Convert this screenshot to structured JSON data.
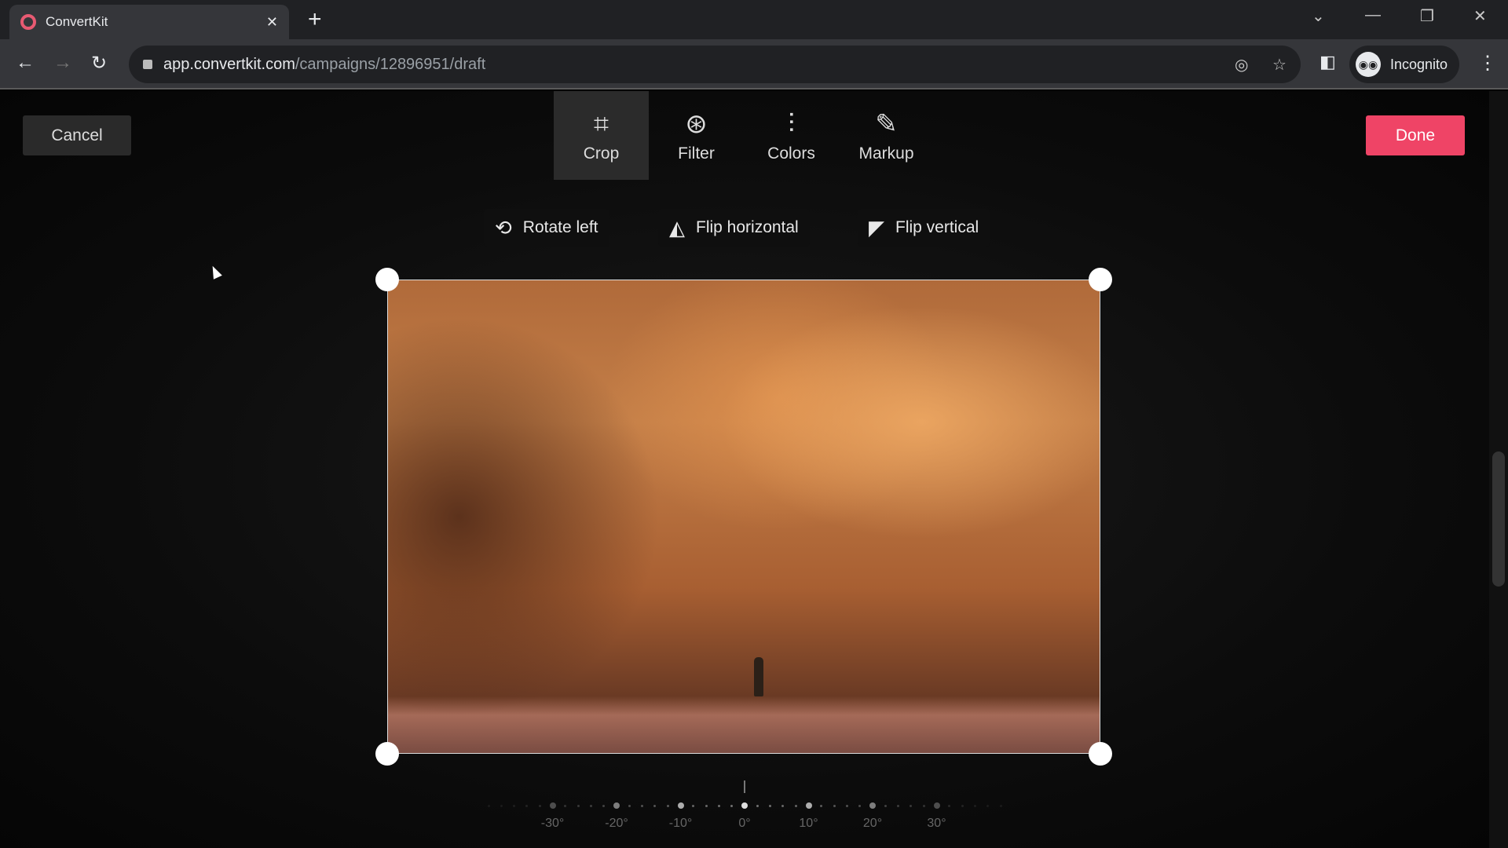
{
  "browser": {
    "tab_title": "ConvertKit",
    "url_host": "app.convertkit.com",
    "url_path": "/campaigns/12896951/draft",
    "profile_label": "Incognito"
  },
  "editor": {
    "cancel_label": "Cancel",
    "done_label": "Done",
    "done_color": "#ef4466",
    "tools": [
      {
        "label": "Crop",
        "icon": "crop-icon",
        "active": true
      },
      {
        "label": "Filter",
        "icon": "filter-icon"
      },
      {
        "label": "Colors",
        "icon": "sliders-icon"
      },
      {
        "label": "Markup",
        "icon": "pencil-icon"
      }
    ],
    "actions": [
      {
        "label": "Rotate left",
        "icon": "rotate-left-icon"
      },
      {
        "label": "Flip horizontal",
        "icon": "flip-horizontal-icon"
      },
      {
        "label": "Flip vertical",
        "icon": "flip-vertical-icon"
      }
    ],
    "rotation": {
      "value_deg": 0,
      "labels": [
        "-30°",
        "-20°",
        "-10°",
        "0°",
        "10°",
        "20°",
        "30°"
      ]
    }
  }
}
